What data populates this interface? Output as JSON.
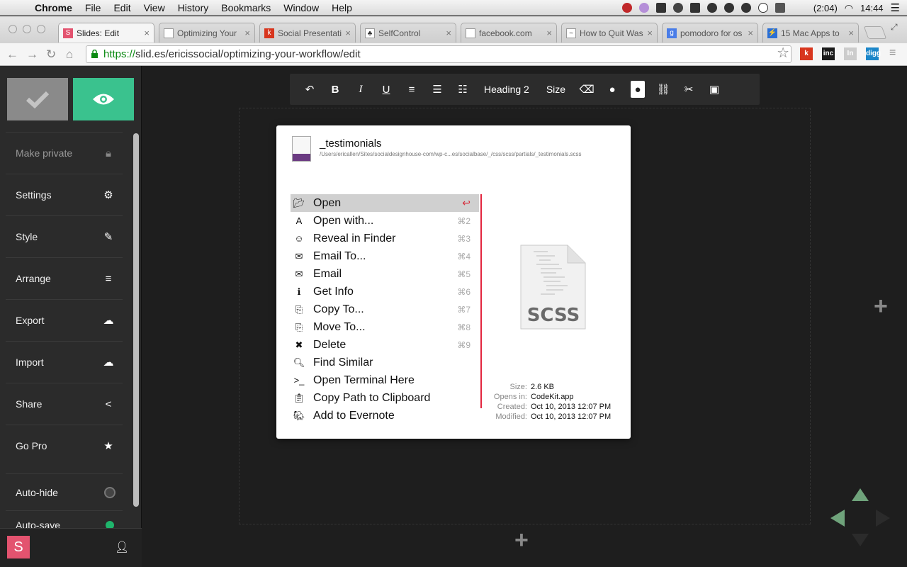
{
  "menubar": {
    "app": "Chrome",
    "items": [
      "File",
      "Edit",
      "View",
      "History",
      "Bookmarks",
      "Window",
      "Help"
    ],
    "battery": "(2:04)",
    "time": "14:44"
  },
  "tabs": [
    {
      "title": "Slides: Edit",
      "fav_color": "#e3536f",
      "fav_glyph": "S"
    },
    {
      "title": "Optimizing Your",
      "fav_color": "#ffffff",
      "fav_glyph": ""
    },
    {
      "title": "Social Presentati",
      "fav_color": "#d8361e",
      "fav_glyph": "k"
    },
    {
      "title": "SelfControl",
      "fav_color": "#ffffff",
      "fav_glyph": "♣"
    },
    {
      "title": "facebook.com",
      "fav_color": "#ffffff",
      "fav_glyph": ""
    },
    {
      "title": "How to Quit Was",
      "fav_color": "#ffffff",
      "fav_glyph": "~"
    },
    {
      "title": "pomodoro for os",
      "fav_color": "#4a7de8",
      "fav_glyph": "g"
    },
    {
      "title": "15 Mac Apps to",
      "fav_color": "#2a6fd6",
      "fav_glyph": "⚡"
    }
  ],
  "address": {
    "scheme": "https://",
    "rest": "slid.es/ericissocial/optimizing-your-workflow/edit"
  },
  "extensions": [
    {
      "label": "k",
      "color": "#d8361e"
    },
    {
      "label": "inc",
      "color": "#1a1a1a"
    },
    {
      "label": "In",
      "color": "#cccccc"
    },
    {
      "label": "digg",
      "color": "#1b86c9"
    }
  ],
  "sidebar": {
    "items": [
      {
        "label": "Make private",
        "icon": "lock-icon",
        "glyph": "🔒︎",
        "dim": true
      },
      {
        "label": "Settings",
        "icon": "gear-icon",
        "glyph": "⚙"
      },
      {
        "label": "Style",
        "icon": "brush-icon",
        "glyph": "✎"
      },
      {
        "label": "Arrange",
        "icon": "layers-icon",
        "glyph": "≡"
      },
      {
        "label": "Export",
        "icon": "cloud-icon",
        "glyph": "☁"
      },
      {
        "label": "Import",
        "icon": "cloud-icon",
        "glyph": "☁"
      },
      {
        "label": "Share",
        "icon": "share-icon",
        "glyph": "<"
      },
      {
        "label": "Go Pro",
        "icon": "star-icon",
        "glyph": "★"
      }
    ],
    "toggles": [
      {
        "label": "Auto-hide",
        "on": false
      },
      {
        "label": "Auto-save",
        "on": true
      }
    ],
    "logo": "S"
  },
  "editor_toolbar": {
    "heading": "Heading 2",
    "size": "Size"
  },
  "popup": {
    "file_name": "_testimonials",
    "file_path": "/Users/ericallen/Sites/socialdesignhouse-com/wp-c...es/socialbase/_/css/scss/partials/_testimonials.scss",
    "actions": [
      {
        "label": "Open",
        "shortcut": "↩",
        "icon": "folder-open-icon",
        "glyph": "📂︎"
      },
      {
        "label": "Open with...",
        "shortcut": "⌘2",
        "icon": "open-with-icon",
        "glyph": "A"
      },
      {
        "label": "Reveal in Finder",
        "shortcut": "⌘3",
        "icon": "finder-icon",
        "glyph": "☺"
      },
      {
        "label": "Email To...",
        "shortcut": "⌘4",
        "icon": "email-to-icon",
        "glyph": "✉"
      },
      {
        "label": "Email",
        "shortcut": "⌘5",
        "icon": "email-icon",
        "glyph": "✉"
      },
      {
        "label": "Get Info",
        "shortcut": "⌘6",
        "icon": "info-icon",
        "glyph": "ℹ"
      },
      {
        "label": "Copy To...",
        "shortcut": "⌘7",
        "icon": "copy-icon",
        "glyph": "⎘"
      },
      {
        "label": "Move To...",
        "shortcut": "⌘8",
        "icon": "move-icon",
        "glyph": "⎘"
      },
      {
        "label": "Delete",
        "shortcut": "⌘9",
        "icon": "delete-icon",
        "glyph": "✖"
      },
      {
        "label": "Find Similar",
        "shortcut": "",
        "icon": "magnifier-icon",
        "glyph": "🔍︎"
      },
      {
        "label": "Open Terminal Here",
        "shortcut": "",
        "icon": "terminal-icon",
        "glyph": ">_"
      },
      {
        "label": "Copy Path to Clipboard",
        "shortcut": "",
        "icon": "clipboard-icon",
        "glyph": "📋︎"
      },
      {
        "label": "Add to Evernote",
        "shortcut": "",
        "icon": "evernote-icon",
        "glyph": "🐘︎"
      }
    ],
    "preview_label": "SCSS",
    "meta": [
      {
        "key": "Size:",
        "value": "2.6 KB"
      },
      {
        "key": "Opens in:",
        "value": "CodeKit.app"
      },
      {
        "key": "Created:",
        "value": "Oct 10, 2013 12:07 PM"
      },
      {
        "key": "Modified:",
        "value": "Oct 10, 2013 12:07 PM"
      }
    ]
  }
}
